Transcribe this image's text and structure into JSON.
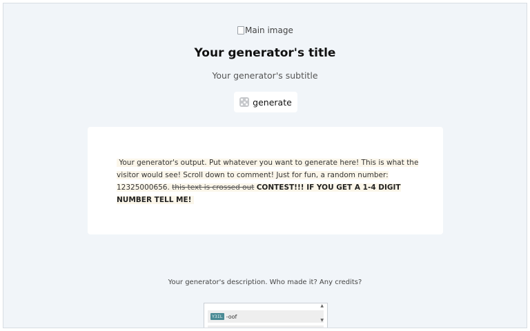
{
  "main_image": {
    "alt": "Main image"
  },
  "header": {
    "title": "Your generator's title",
    "subtitle": "Your generator's subtitle"
  },
  "generate_button": {
    "label": "generate",
    "icon": "dice-icon"
  },
  "output": {
    "text_before": "Your generator's output. Put whatever you want to generate here! This is what the visitor would see! Scroll down to comment! Just for fun, a random number: 12325000656.",
    "strikethrough": "this text is crossed out",
    "bold": "CONTEST!!! IF YOU GET A 1-4 DIGIT NUMBER TELL ME!"
  },
  "description": "Your generator's description. Who made it? Any credits?",
  "comments": {
    "items": [
      {
        "badge": "Y3IL",
        "text": "-oof"
      }
    ]
  },
  "colors": {
    "page_background": "#f1f5f9",
    "card_background": "#ffffff",
    "output_highlight": "#fbf6ea",
    "badge": "#4a8a94"
  }
}
